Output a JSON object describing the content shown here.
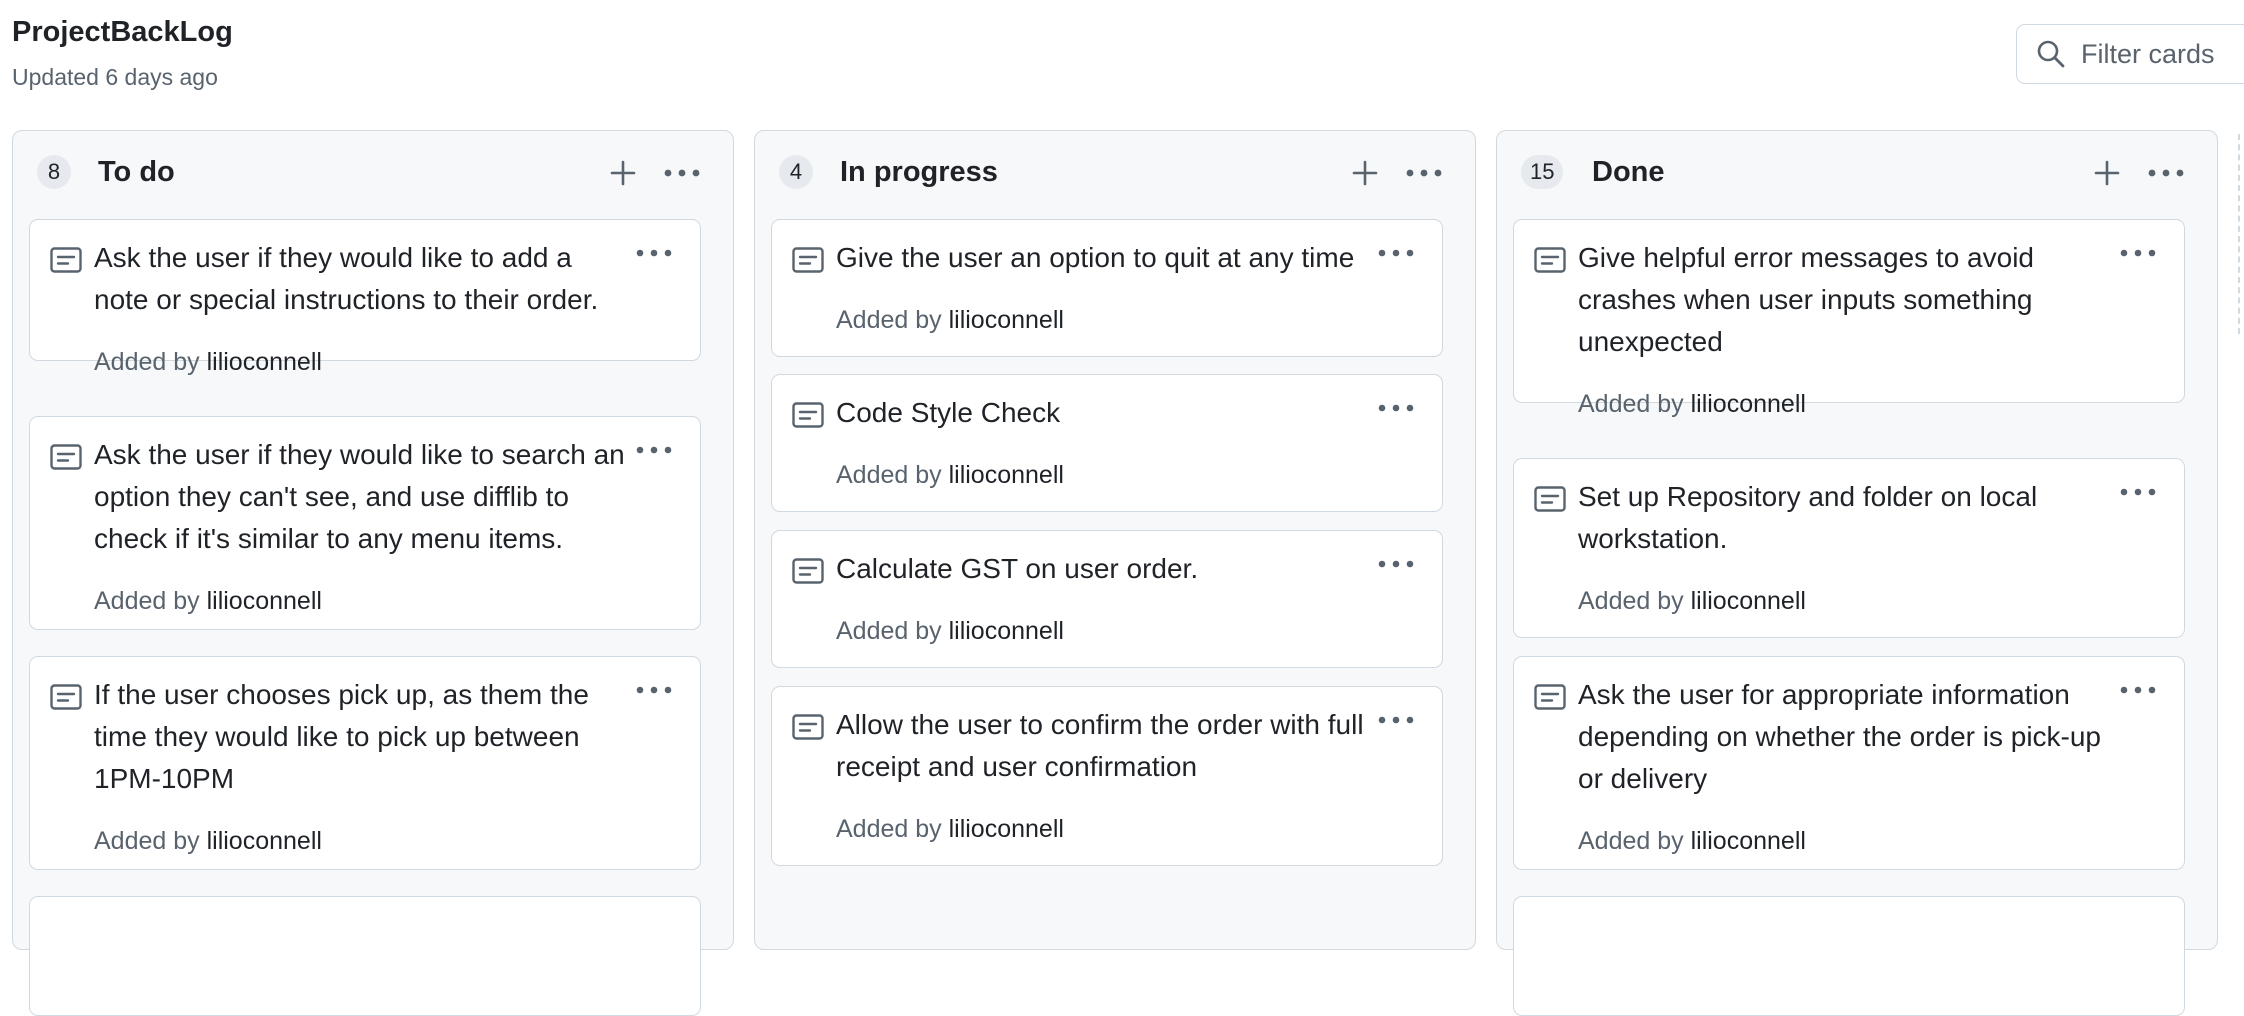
{
  "board": {
    "title": "ProjectBackLog",
    "updated": "Updated 6 days ago"
  },
  "filter": {
    "placeholder": "Filter cards",
    "icon": "search-icon"
  },
  "icons": {
    "card": "note-icon",
    "add": "plus-icon",
    "more": "kebab-horizontal-icon"
  },
  "colors": {
    "column_bg": "#f6f8fa",
    "border": "#d1d9e0",
    "muted_text": "#59636e",
    "text": "#1f2328",
    "count_badge": "#e6eaef"
  },
  "columns": [
    {
      "count": "8",
      "title": "To do",
      "cards": [
        {
          "text": "Ask the user if they would like to add a note or special instructions to their order.",
          "added_by": "Added by",
          "user": "lilioconnell"
        },
        {
          "text": "Ask the user if they would like to search an option they can't see, and use difflib to check if it's similar to any menu items.",
          "added_by": "Added by",
          "user": "lilioconnell"
        },
        {
          "text": "If the user chooses pick up, as them the time they would like to pick up between 1PM-10PM",
          "added_by": "Added by",
          "user": "lilioconnell"
        }
      ]
    },
    {
      "count": "4",
      "title": "In progress",
      "cards": [
        {
          "text": "Give the user an option to quit at any time",
          "added_by": "Added by",
          "user": "lilioconnell"
        },
        {
          "text": "Code Style Check",
          "added_by": "Added by",
          "user": "lilioconnell"
        },
        {
          "text": "Calculate GST on user order.",
          "added_by": "Added by",
          "user": "lilioconnell"
        },
        {
          "text": "Allow the user to confirm the order with full receipt and user confirmation",
          "added_by": "Added by",
          "user": "lilioconnell"
        }
      ]
    },
    {
      "count": "15",
      "title": "Done",
      "cards": [
        {
          "text": "Give helpful error messages to avoid crashes when user inputs something unexpected",
          "added_by": "Added by",
          "user": "lilioconnell"
        },
        {
          "text": "Set up Repository and folder on local workstation.",
          "added_by": "Added by",
          "user": "lilioconnell"
        },
        {
          "text": "Ask the user for appropriate information depending on whether the order is pick-up or delivery",
          "added_by": "Added by",
          "user": "lilioconnell"
        }
      ]
    }
  ]
}
